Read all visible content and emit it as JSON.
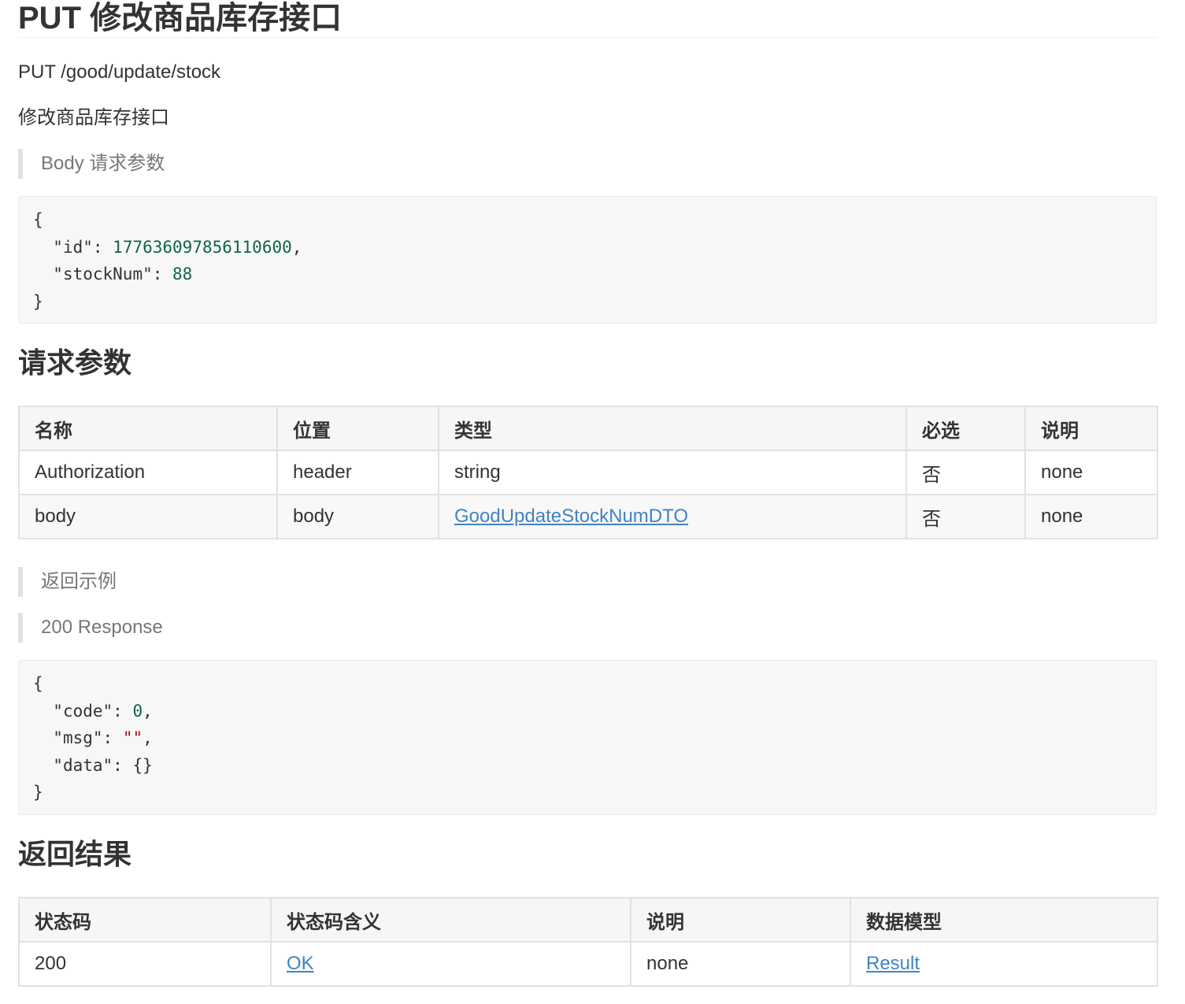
{
  "title": "PUT 修改商品库存接口",
  "endpoint": "PUT /good/update/stock",
  "description": "修改商品库存接口",
  "body_params_label": "Body 请求参数",
  "body_example": {
    "open": "{",
    "lines": [
      {
        "key": "\"id\"",
        "sep": ": ",
        "value": "177636097856110600",
        "value_kind": "num",
        "trail": ","
      },
      {
        "key": "\"stockNum\"",
        "sep": ": ",
        "value": "88",
        "value_kind": "num",
        "trail": ""
      }
    ],
    "close": "}"
  },
  "request_params": {
    "heading": "请求参数",
    "columns": [
      "名称",
      "位置",
      "类型",
      "必选",
      "说明"
    ],
    "rows": [
      {
        "name": "Authorization",
        "in": "header",
        "type": "string",
        "type_is_link": false,
        "required": "否",
        "desc": "none"
      },
      {
        "name": "body",
        "in": "body",
        "type": "GoodUpdateStockNumDTO",
        "type_is_link": true,
        "required": "否",
        "desc": "none"
      }
    ]
  },
  "response_example_label": "返回示例",
  "response_200_label": "200 Response",
  "response_example": {
    "open": "{",
    "lines": [
      {
        "key": "\"code\"",
        "sep": ": ",
        "value": "0",
        "value_kind": "num",
        "trail": ","
      },
      {
        "key": "\"msg\"",
        "sep": ": ",
        "value": "\"\"",
        "value_kind": "str",
        "trail": ","
      },
      {
        "key": "\"data\"",
        "sep": ": ",
        "value": "{}",
        "value_kind": "plain",
        "trail": ""
      }
    ],
    "close": "}"
  },
  "response_results": {
    "heading": "返回结果",
    "columns": [
      "状态码",
      "状态码含义",
      "说明",
      "数据模型"
    ],
    "rows": [
      {
        "code": "200",
        "meaning": "OK",
        "desc": "none",
        "model": "Result"
      }
    ]
  },
  "colors": {
    "text": "#333333",
    "muted": "#777777",
    "link": "#4183c4",
    "code_number": "#116644",
    "code_string": "#aa1111",
    "code_bg": "#f7f7f7",
    "table_border": "#dfe2e5"
  }
}
